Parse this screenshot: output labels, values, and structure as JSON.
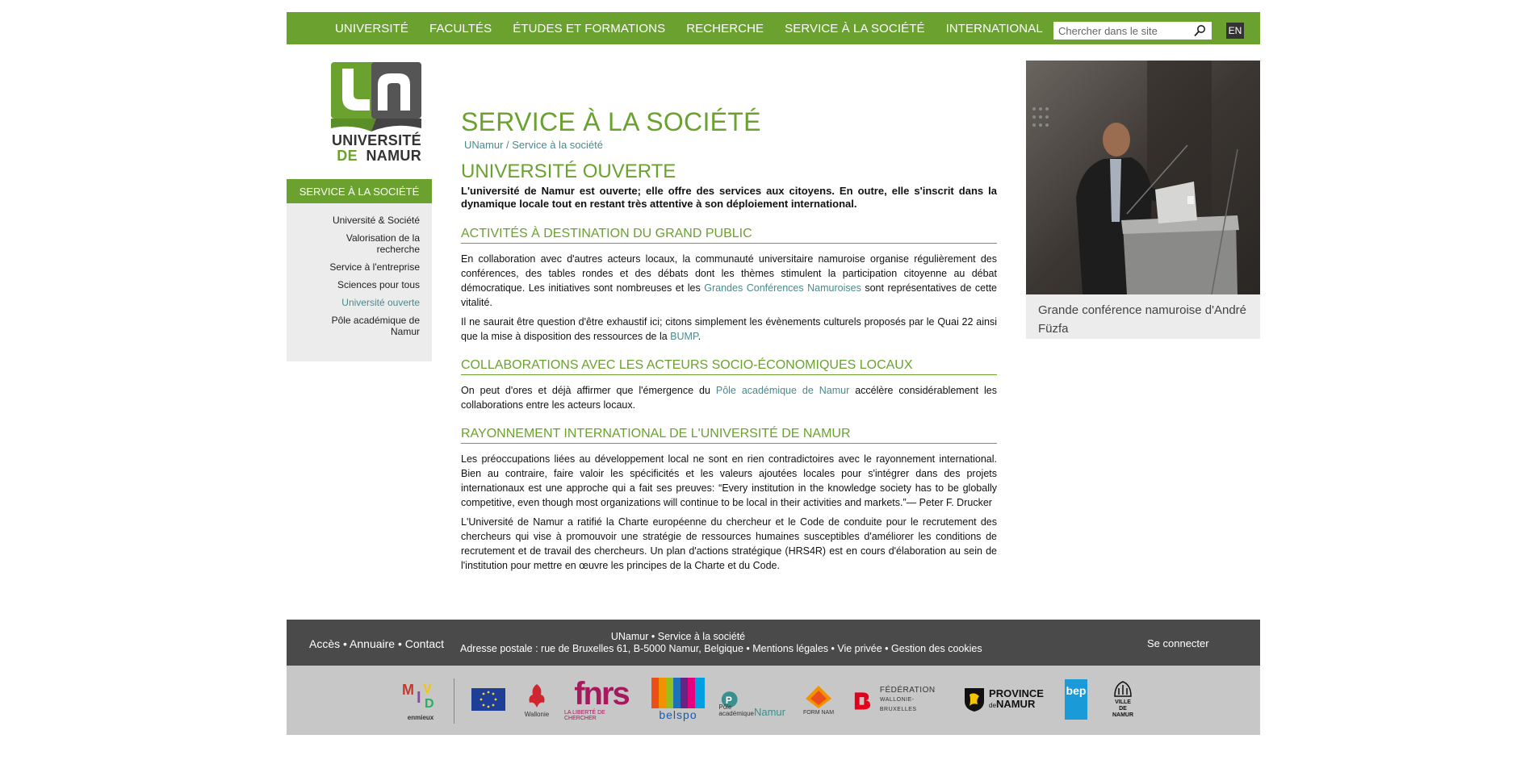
{
  "nav": {
    "items": [
      "UNIVERSITÉ",
      "FACULTÉS",
      "ÉTUDES ET FORMATIONS",
      "RECHERCHE",
      "SERVICE À LA SOCIÉTÉ",
      "INTERNATIONAL"
    ],
    "search_placeholder": "Chercher dans le site",
    "lang": "EN"
  },
  "logo": {
    "line1": "UNIVERSITÉ",
    "line2_de": "DE",
    "line2_namur": "NAMUR"
  },
  "sidebar": {
    "title": "SERVICE À LA SOCIÉTÉ",
    "items": [
      {
        "label": "Université & Société",
        "active": false
      },
      {
        "label": "Valorisation de la recherche",
        "active": false
      },
      {
        "label": "Service à l'entreprise",
        "active": false
      },
      {
        "label": "Sciences pour tous",
        "active": false
      },
      {
        "label": "Université ouverte",
        "active": true
      },
      {
        "label": "Pôle académique de Namur",
        "active": false
      }
    ]
  },
  "main": {
    "page_title": "SERVICE À LA SOCIÉTÉ",
    "breadcrumb": {
      "home": "UNamur",
      "sep": " / ",
      "current": "Service à la société"
    },
    "section_title": "UNIVERSITÉ OUVERTE",
    "lead": "L'université de Namur est ouverte; elle offre des services aux citoyens. En outre, elle s'inscrit dans la dynamique locale tout en restant très attentive à son déploiement international.",
    "s1": {
      "title": "ACTIVITÉS À DESTINATION DU GRAND PUBLIC",
      "p1a": "En collaboration avec d'autres acteurs locaux, la communauté universitaire namuroise organise régulièrement des conférences, des tables rondes et des débats dont les thèmes stimulent la participation citoyenne au débat démocratique. Les initiatives sont nombreuses et les ",
      "p1link": "Grandes Conférences Namuroises",
      "p1b": " sont représentatives de cette vitalité.",
      "p2a": "Il ne saurait être question d'être exhaustif ici; citons simplement les évènements culturels proposés par le Quai 22 ainsi que la mise à disposition des ressources de la ",
      "p2link": "BUMP",
      "p2b": "."
    },
    "s2": {
      "title": "COLLABORATIONS AVEC LES ACTEURS SOCIO-ÉCONOMIQUES LOCAUX",
      "p1a": "On peut d'ores et déjà affirmer que l'émergence du ",
      "p1link": "Pôle académique de Namur",
      "p1b": " accélère considérablement les collaborations entre les acteurs locaux."
    },
    "s3": {
      "title": "RAYONNEMENT INTERNATIONAL DE L'UNIVERSITÉ DE NAMUR",
      "p1": "Les préoccupations liées au développement local ne sont en rien contradictoires avec le rayonnement international. Bien au contraire, faire valoir les spécificités et les valeurs ajoutées locales pour s'intégrer dans des projets internationaux est une approche qui a fait ses preuves: “Every institution in the knowledge society has to be globally competitive, even though most organizations will continue to be local in their activities and markets.”— Peter F. Drucker",
      "p2": "L'Université de Namur a ratifié la Charte européenne du chercheur et le Code de conduite pour le recrutement des chercheurs qui vise à promouvoir une stratégie de ressources humaines susceptibles d'améliorer les conditions de recrutement et de travail des chercheurs. Un plan d'actions stratégique (HRS4R) est en cours d'élaboration au sein de l'institution pour mettre en œuvre les principes de la Charte et du Code."
    }
  },
  "photo": {
    "caption": "Grande conférence namuroise d'André Füzfa"
  },
  "footer": {
    "links": [
      "Accès",
      "Annuaire",
      "Contact"
    ],
    "bullet": " • ",
    "center_line1": "UNamur • Service à la société",
    "center_line2": "Adresse postale : rue de Bruxelles 61, B-5000 Namur, Belgique • Mentions légales • Vie privée • Gestion des cookies",
    "login": "Se connecter"
  },
  "partners": {
    "enmieux": "enmieux",
    "wallonie": "Wallonie",
    "fnrs": "fnrs",
    "fnrs_tag": "LA LIBERTÉ DE CHERCHER",
    "belspo": "belspo",
    "pole_a": "Pôle",
    "pole_b": "académique",
    "pole_c": "Namur",
    "formanam": "FORM NAM",
    "federation_1": "FÉDÉRATION",
    "federation_2": "WALLONIE-BRUXELLES",
    "province_1": "PROVINCE",
    "province_de": "de",
    "province_2": "NAMUR",
    "bep": "bep",
    "ville_1": "VILLE",
    "ville_de": "DE",
    "ville_2": "NAMUR"
  },
  "colors": {
    "brand_green": "#6aa12f",
    "link_teal": "#4a8a8c",
    "footer_dark": "#4a4a4a",
    "footer_light": "#c7c7c7"
  }
}
